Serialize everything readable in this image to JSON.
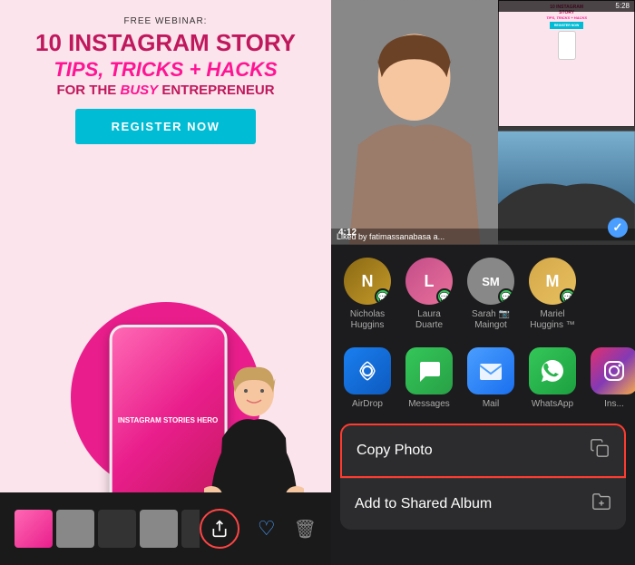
{
  "left": {
    "free_webinar": "FREE WEBINAR:",
    "main_title": "10 INSTAGRAM STORY",
    "subtitle": "TIPS, TRICKS + HACKS",
    "for_the": "FOR THE",
    "busy": "busy",
    "entrepreneur": "ENTREPRENEUR",
    "register_btn": "REGISTER NOW",
    "phone_text": "INSTAGRAM STORIES HERO"
  },
  "right": {
    "status_time": "5:28",
    "time_indicator": "4:12",
    "checkmark": "✓"
  },
  "contacts": [
    {
      "name": "Nicholas\nHuggins",
      "initials": "N",
      "color_class": "avatar-nicholas"
    },
    {
      "name": "Laura\nDuarte",
      "initials": "L",
      "color_class": "avatar-laura"
    },
    {
      "name": "Sarah\nMaingot",
      "initials": "SM",
      "color_class": "avatar-sarah"
    },
    {
      "name": "Mariel\nHuggins",
      "initials": "M",
      "color_class": "avatar-mariel"
    }
  ],
  "apps": [
    {
      "name": "AirDrop",
      "icon_class": "app-icon-airdrop",
      "symbol": "📡"
    },
    {
      "name": "Messages",
      "icon_class": "app-icon-messages",
      "symbol": "💬"
    },
    {
      "name": "Mail",
      "icon_class": "app-icon-mail",
      "symbol": "✉️"
    },
    {
      "name": "WhatsApp",
      "icon_class": "app-icon-whatsapp",
      "symbol": "📱"
    },
    {
      "name": "Ins...",
      "icon_class": "app-icon-instagram",
      "symbol": "📷"
    }
  ],
  "actions": [
    {
      "label": "Copy Photo",
      "icon": "📋"
    },
    {
      "label": "Add to Shared Album",
      "icon": "📁"
    }
  ]
}
